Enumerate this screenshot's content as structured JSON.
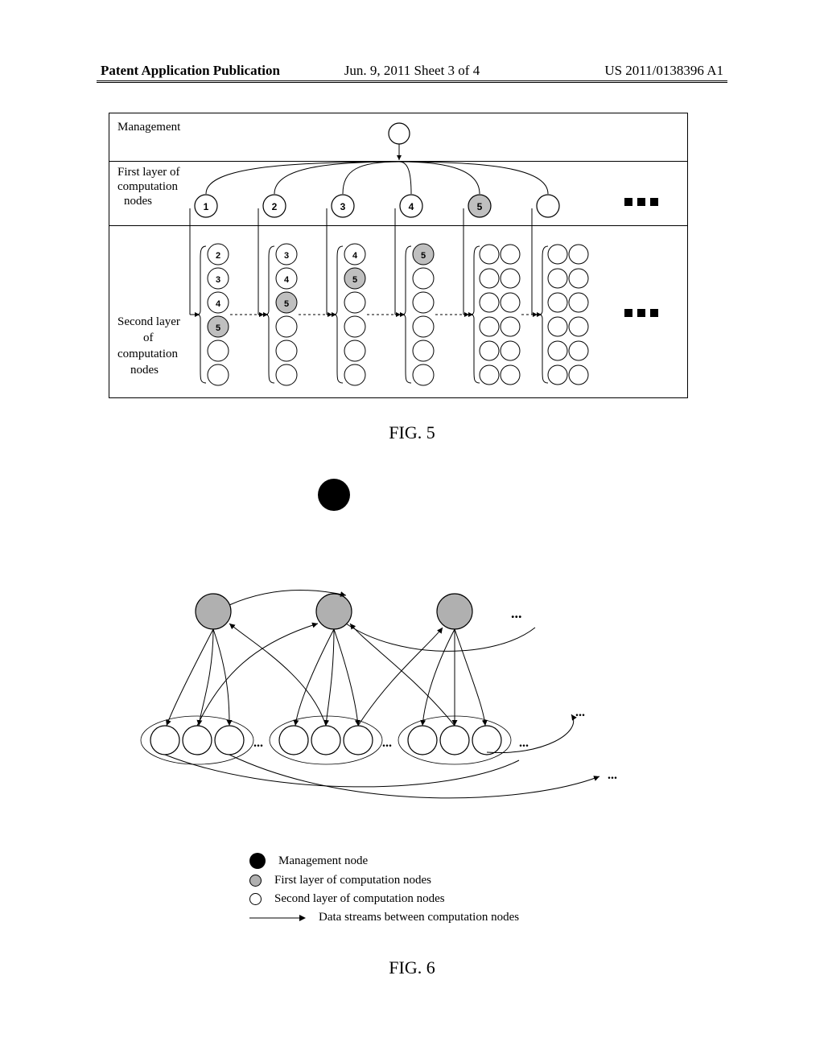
{
  "header": {
    "left": "Patent Application Publication",
    "center": "Jun. 9, 2011   Sheet 3 of 4",
    "right": "US 2011/0138396 A1"
  },
  "fig5": {
    "row1_label": "Management",
    "row2_label_line1": "First layer of",
    "row2_label_line2": "computation",
    "row2_label_line3": "nodes",
    "row3_label_line1": "Second layer",
    "row3_label_line2": "of",
    "row3_label_line3": "computation",
    "row3_label_line4": "nodes",
    "first_nodes": [
      "1",
      "2",
      "3",
      "4",
      "5",
      ""
    ],
    "caption": "FIG. 5"
  },
  "fig6": {
    "caption": "FIG. 6",
    "legend": {
      "management": "Management node",
      "first_layer": "First layer of computation nodes",
      "second_layer": "Second layer of computation nodes",
      "streams": "Data streams between computation nodes"
    }
  },
  "chart_data": {
    "type": "diagram",
    "figures": [
      {
        "id": "FIG.5",
        "description": "Hierarchical tree: one Management node fans out to First-layer computation nodes 1..N; each first-layer node fans out to a column of Second-layer computation nodes. Some second-layer nodes shaded (index 5 examples). Horizontal dashed arrows between adjacent second-layer columns.",
        "layers": [
          "Management",
          "First layer of computation nodes",
          "Second layer of computation nodes"
        ],
        "first_layer_visible_labels": [
          1,
          2,
          3,
          4,
          5
        ],
        "shaded_nodes_label": 5
      },
      {
        "id": "FIG.6",
        "description": "Network graph: black Management node at top; three grey first-layer nodes; groups of white second-layer nodes below; curved directed edges represent data streams between nodes.",
        "node_types": {
          "management": "black filled",
          "first_layer": "grey filled",
          "second_layer": "white outline"
        },
        "edges": "bidirectional data streams between layers and within second layer groups"
      }
    ]
  }
}
